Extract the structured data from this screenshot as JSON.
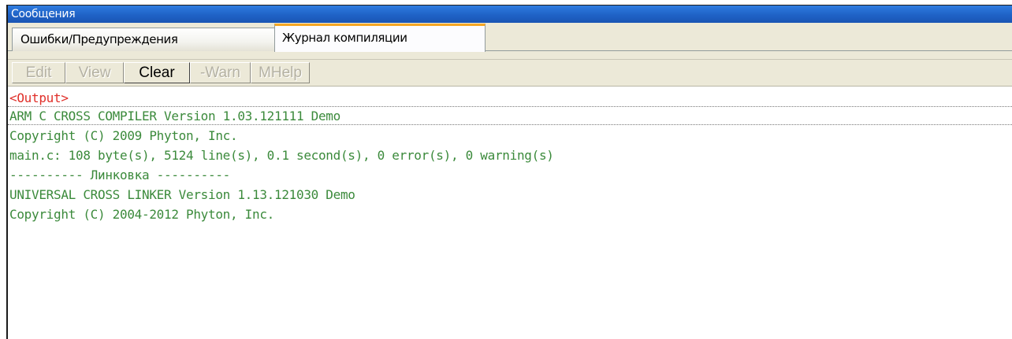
{
  "window": {
    "title": "Сообщения"
  },
  "tabs": [
    {
      "label": "Ошибки/Предупреждения",
      "active": false
    },
    {
      "label": "Журнал компиляции",
      "active": true
    }
  ],
  "toolbar": {
    "buttons": [
      {
        "label": "Edit",
        "enabled": false
      },
      {
        "label": "View",
        "enabled": false
      },
      {
        "label": "Clear",
        "enabled": true
      },
      {
        "label": "-Warn",
        "enabled": false
      },
      {
        "label": "MHelp",
        "enabled": false
      }
    ]
  },
  "output": {
    "header": "<Output>",
    "lines": [
      "ARM C CROSS COMPILER Version 1.03.121111 Demo",
      "Copyright (C) 2009 Phyton, Inc.",
      "main.c: 108 byte(s), 5124 line(s), 0.1 second(s), 0 error(s), 0 warning(s)",
      "---------- Линковка ----------",
      "UNIVERSAL CROSS LINKER Version 1.13.121030 Demo",
      "Copyright (C) 2004-2012 Phyton, Inc."
    ],
    "selected_line_index": 0
  },
  "colors": {
    "titlebar": "#1f62c6",
    "output_text": "#3b8a3b",
    "output_header": "#e0302a",
    "active_tab_accent": "#f5a623"
  }
}
